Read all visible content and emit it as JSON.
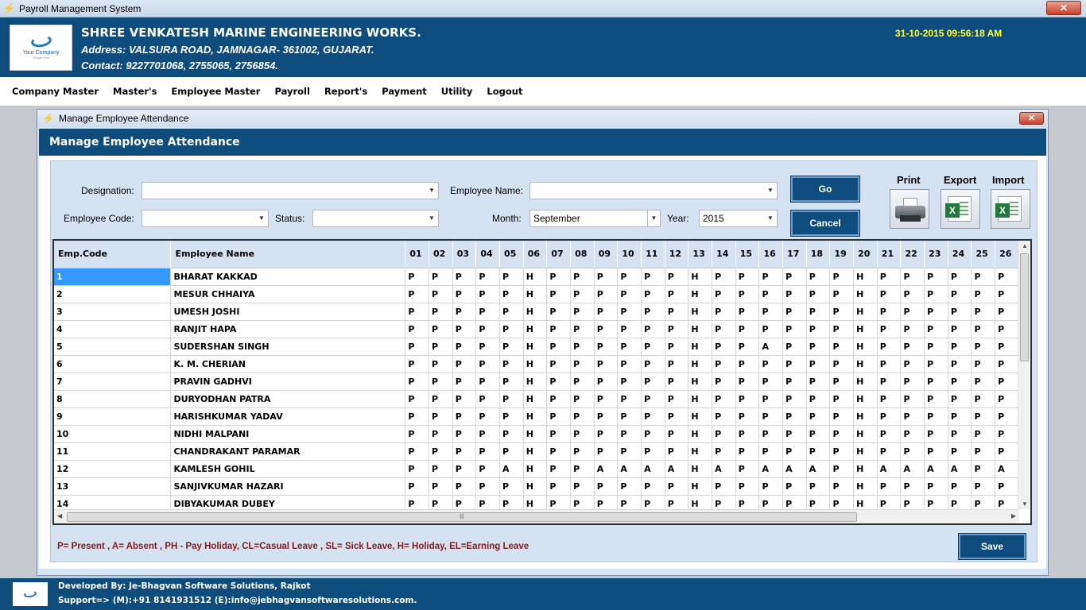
{
  "window": {
    "title": "Payroll Management System",
    "close": "✕"
  },
  "header": {
    "logo_text": "Your Company",
    "logo_sub": "Slogan here",
    "company_name": "SHREE VENKATESH MARINE ENGINEERING WORKS.",
    "address": "Address: VALSURA ROAD, JAMNAGAR- 361002, GUJARAT.",
    "contact": "Contact: 9227701068, 2755065, 2756854.",
    "datetime": "31-10-2015 09:56:18 AM"
  },
  "menu": [
    "Company Master",
    "Master's",
    "Employee Master",
    "Payroll",
    "Report's",
    "Payment",
    "Utility",
    "Logout"
  ],
  "dialog": {
    "title": "Manage Employee Attendance",
    "heading": "Manage Employee Attendance",
    "close": "✕"
  },
  "filters": {
    "designation_label": "Designation:",
    "designation_value": "",
    "employee_name_label": "Employee Name:",
    "employee_name_value": "",
    "employee_code_label": "Employee Code:",
    "employee_code_value": "",
    "status_label": "Status:",
    "status_value": "",
    "month_label": "Month:",
    "month_value": "September",
    "year_label": "Year:",
    "year_value": "2015"
  },
  "buttons": {
    "go": "Go",
    "cancel": "Cancel",
    "save": "Save"
  },
  "tools": {
    "print": "Print",
    "export": "Export",
    "import": "Import"
  },
  "grid": {
    "headers": {
      "code": "Emp.Code",
      "name": "Employee Name"
    },
    "days": [
      "01",
      "02",
      "03",
      "04",
      "05",
      "06",
      "07",
      "08",
      "09",
      "10",
      "11",
      "12",
      "13",
      "14",
      "15",
      "16",
      "17",
      "18",
      "19",
      "20",
      "21",
      "22",
      "23",
      "24",
      "25",
      "26"
    ],
    "rows": [
      {
        "code": "1",
        "name": "BHARAT KAKKAD",
        "att": [
          "P",
          "P",
          "P",
          "P",
          "P",
          "H",
          "P",
          "P",
          "P",
          "P",
          "P",
          "P",
          "H",
          "P",
          "P",
          "P",
          "P",
          "P",
          "P",
          "H",
          "P",
          "P",
          "P",
          "P",
          "P",
          "P"
        ]
      },
      {
        "code": "2",
        "name": "MESUR CHHAIYA",
        "att": [
          "P",
          "P",
          "P",
          "P",
          "P",
          "H",
          "P",
          "P",
          "P",
          "P",
          "P",
          "P",
          "H",
          "P",
          "P",
          "P",
          "P",
          "P",
          "P",
          "H",
          "P",
          "P",
          "P",
          "P",
          "P",
          "P"
        ]
      },
      {
        "code": "3",
        "name": "UMESH JOSHI",
        "att": [
          "P",
          "P",
          "P",
          "P",
          "P",
          "H",
          "P",
          "P",
          "P",
          "P",
          "P",
          "P",
          "H",
          "P",
          "P",
          "P",
          "P",
          "P",
          "P",
          "H",
          "P",
          "P",
          "P",
          "P",
          "P",
          "P"
        ]
      },
      {
        "code": "4",
        "name": "RANJIT HAPA",
        "att": [
          "P",
          "P",
          "P",
          "P",
          "P",
          "H",
          "P",
          "P",
          "P",
          "P",
          "P",
          "P",
          "H",
          "P",
          "P",
          "P",
          "P",
          "P",
          "P",
          "H",
          "P",
          "P",
          "P",
          "P",
          "P",
          "P"
        ]
      },
      {
        "code": "5",
        "name": "SUDERSHAN SINGH",
        "att": [
          "P",
          "P",
          "P",
          "P",
          "P",
          "H",
          "P",
          "P",
          "P",
          "P",
          "P",
          "P",
          "H",
          "P",
          "P",
          "A",
          "P",
          "P",
          "P",
          "H",
          "P",
          "P",
          "P",
          "P",
          "P",
          "P"
        ]
      },
      {
        "code": "6",
        "name": "K. M. CHERIAN",
        "att": [
          "P",
          "P",
          "P",
          "P",
          "P",
          "H",
          "P",
          "P",
          "P",
          "P",
          "P",
          "P",
          "H",
          "P",
          "P",
          "P",
          "P",
          "P",
          "P",
          "H",
          "P",
          "P",
          "P",
          "P",
          "P",
          "P"
        ]
      },
      {
        "code": "7",
        "name": "PRAVIN GADHVI",
        "att": [
          "P",
          "P",
          "P",
          "P",
          "P",
          "H",
          "P",
          "P",
          "P",
          "P",
          "P",
          "P",
          "H",
          "P",
          "P",
          "P",
          "P",
          "P",
          "P",
          "H",
          "P",
          "P",
          "P",
          "P",
          "P",
          "P"
        ]
      },
      {
        "code": "8",
        "name": "DURYODHAN PATRA",
        "att": [
          "P",
          "P",
          "P",
          "P",
          "P",
          "H",
          "P",
          "P",
          "P",
          "P",
          "P",
          "P",
          "H",
          "P",
          "P",
          "P",
          "P",
          "P",
          "P",
          "H",
          "P",
          "P",
          "P",
          "P",
          "P",
          "P"
        ]
      },
      {
        "code": "9",
        "name": "HARISHKUMAR YADAV",
        "att": [
          "P",
          "P",
          "P",
          "P",
          "P",
          "H",
          "P",
          "P",
          "P",
          "P",
          "P",
          "P",
          "H",
          "P",
          "P",
          "P",
          "P",
          "P",
          "P",
          "H",
          "P",
          "P",
          "P",
          "P",
          "P",
          "P"
        ]
      },
      {
        "code": "10",
        "name": "NIDHI MALPANI",
        "att": [
          "P",
          "P",
          "P",
          "P",
          "P",
          "H",
          "P",
          "P",
          "P",
          "P",
          "P",
          "P",
          "H",
          "P",
          "P",
          "P",
          "P",
          "P",
          "P",
          "H",
          "P",
          "P",
          "P",
          "P",
          "P",
          "P"
        ]
      },
      {
        "code": "11",
        "name": "CHANDRAKANT PARAMAR",
        "att": [
          "P",
          "P",
          "P",
          "P",
          "P",
          "H",
          "P",
          "P",
          "P",
          "P",
          "P",
          "P",
          "H",
          "P",
          "P",
          "P",
          "P",
          "P",
          "P",
          "H",
          "P",
          "P",
          "P",
          "P",
          "P",
          "P"
        ]
      },
      {
        "code": "12",
        "name": "KAMLESH GOHIL",
        "att": [
          "P",
          "P",
          "P",
          "P",
          "A",
          "H",
          "P",
          "P",
          "A",
          "A",
          "A",
          "A",
          "H",
          "A",
          "P",
          "A",
          "A",
          "A",
          "P",
          "H",
          "A",
          "A",
          "A",
          "A",
          "P",
          "A"
        ]
      },
      {
        "code": "13",
        "name": "SANJIVKUMAR HAZARI",
        "att": [
          "P",
          "P",
          "P",
          "P",
          "P",
          "H",
          "P",
          "P",
          "P",
          "P",
          "P",
          "P",
          "H",
          "P",
          "P",
          "P",
          "P",
          "P",
          "P",
          "H",
          "P",
          "P",
          "P",
          "P",
          "P",
          "P"
        ]
      },
      {
        "code": "14",
        "name": "DIBYAKUMAR DUBEY",
        "att": [
          "P",
          "P",
          "P",
          "P",
          "P",
          "H",
          "P",
          "P",
          "P",
          "P",
          "P",
          "P",
          "H",
          "P",
          "P",
          "P",
          "P",
          "P",
          "P",
          "H",
          "P",
          "P",
          "P",
          "P",
          "P",
          "P"
        ]
      }
    ]
  },
  "legend": "P= Present , A= Absent , PH - Pay Holiday, CL=Casual Leave , SL= Sick  Leave, H= Holiday, EL=Earning Leave",
  "footer": {
    "developed_by": "Developed By: Je-Bhagvan Software Solutions, Rajkot",
    "support": "Support=> (M):+91 8141931512 (E):info@jebhagvansoftwaresolutions.com."
  },
  "icons": {
    "app": "lightning-icon",
    "print": "printer-icon",
    "export": "excel-icon",
    "import": "excel-icon"
  },
  "colors": {
    "brand": "#0f4c7e",
    "datetime": "#ffff22",
    "legend": "#8b1a1a",
    "selection": "#3399ff"
  }
}
